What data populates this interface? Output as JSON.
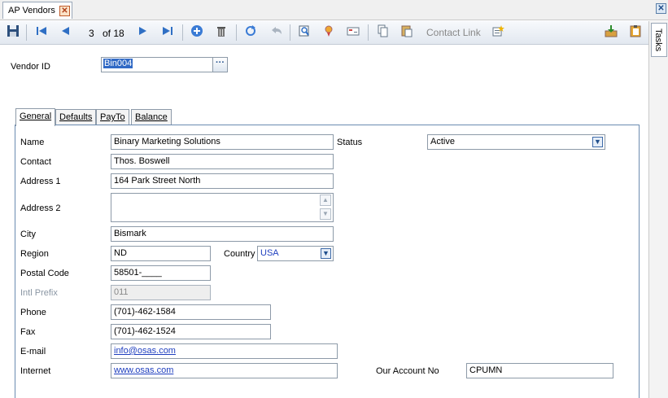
{
  "window": {
    "tab_title": "AP Vendors",
    "close_glyph": "✕",
    "pane_close_glyph": "✕"
  },
  "toolbar": {
    "icons": [
      "save-icon",
      "first-record-icon",
      "previous-record-icon",
      "next-record-icon",
      "last-record-icon",
      "new-record-icon",
      "delete-icon",
      "refresh-icon",
      "undo-icon",
      "find-icon",
      "locate-icon",
      "card-icon",
      "copy-icon",
      "paste-icon",
      "new-item-icon",
      "import-icon",
      "clipboard-icon"
    ],
    "record_position": "3",
    "record_total": "of 18",
    "contact_link": "Contact Link"
  },
  "side": {
    "tasks_label": "Tasks"
  },
  "vendor": {
    "id_label": "Vendor ID",
    "id_value": "Bin004",
    "lookup_glyph": "···"
  },
  "tabs": [
    {
      "label": "General",
      "active": true
    },
    {
      "label": "Defaults",
      "active": false
    },
    {
      "label": "PayTo",
      "active": false
    },
    {
      "label": "Balance",
      "active": false
    }
  ],
  "general": {
    "name_label": "Name",
    "name_value": "Binary Marketing Solutions",
    "status_label": "Status",
    "status_value": "Active",
    "contact_label": "Contact",
    "contact_value": "Thos. Boswell",
    "address1_label": "Address 1",
    "address1_value": "164 Park Street North",
    "address2_label": "Address 2",
    "address2_value": "",
    "city_label": "City",
    "city_value": "Bismark",
    "region_label": "Region",
    "region_value": "ND",
    "country_label": "Country",
    "country_value": "USA",
    "postal_label": "Postal Code",
    "postal_value": "58501-____",
    "intl_prefix_label": "Intl Prefix",
    "intl_prefix_value": "011",
    "phone_label": "Phone",
    "phone_value": "(701)-462-1584",
    "fax_label": "Fax",
    "fax_value": "(701)-462-1524",
    "email_label": "E-mail",
    "email_value": "info@osas.com",
    "internet_label": "Internet",
    "internet_value": "www.osas.com",
    "account_label": "Our Account No",
    "account_value": "CPUMN"
  },
  "colors": {
    "accent": "#316ac5",
    "link": "#1f3fbf",
    "panel_border": "#6b8bb0"
  }
}
